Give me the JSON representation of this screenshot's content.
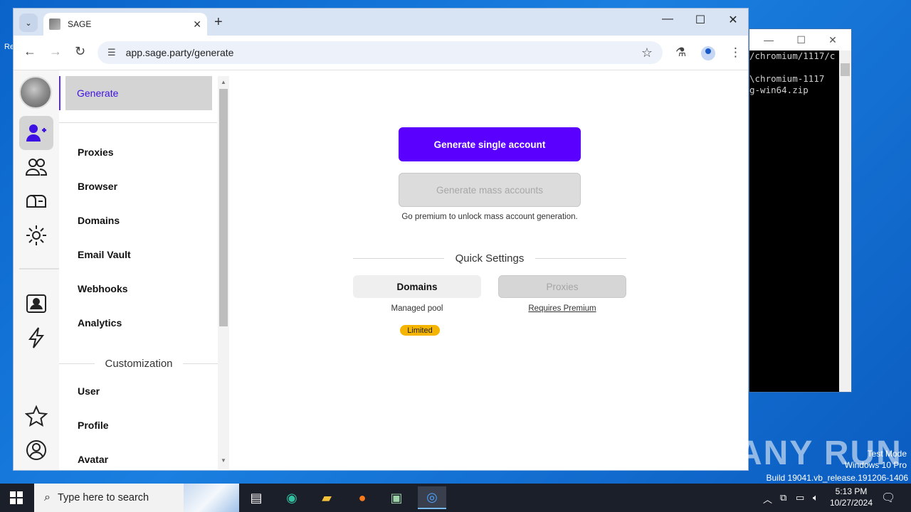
{
  "browser": {
    "tab_title": "SAGE",
    "url": "app.sage.party/generate"
  },
  "menu": {
    "active": "Generate",
    "items": [
      "Proxies",
      "Browser",
      "Domains",
      "Email Vault",
      "Webhooks",
      "Analytics"
    ],
    "section_title": "Customization",
    "custom_items": [
      "User",
      "Profile",
      "Avatar"
    ]
  },
  "main": {
    "primary_button": "Generate single account",
    "mass_button": "Generate mass accounts",
    "premium_note": "Go premium to unlock mass account generation.",
    "quick_settings_title": "Quick Settings",
    "domains_button": "Domains",
    "domains_sub": "Managed pool",
    "domains_badge": "Limited",
    "proxies_button": "Proxies",
    "proxies_sub": "Requires Premium",
    "accent_color": "#5a00ff",
    "badge_color": "#f5b400"
  },
  "console": {
    "text": "/chromium/1117/c\n\n\\chromium-1117\ng-win64.zip"
  },
  "taskbar": {
    "search_placeholder": "Type here to search",
    "time": "5:13 PM",
    "date": "10/27/2024"
  },
  "watermark": {
    "line1": "Test Mode",
    "line2": "Windows 10 Pro",
    "line3": "Build 19041.vb_release.191206-1406",
    "brand": "ANY RUN"
  }
}
